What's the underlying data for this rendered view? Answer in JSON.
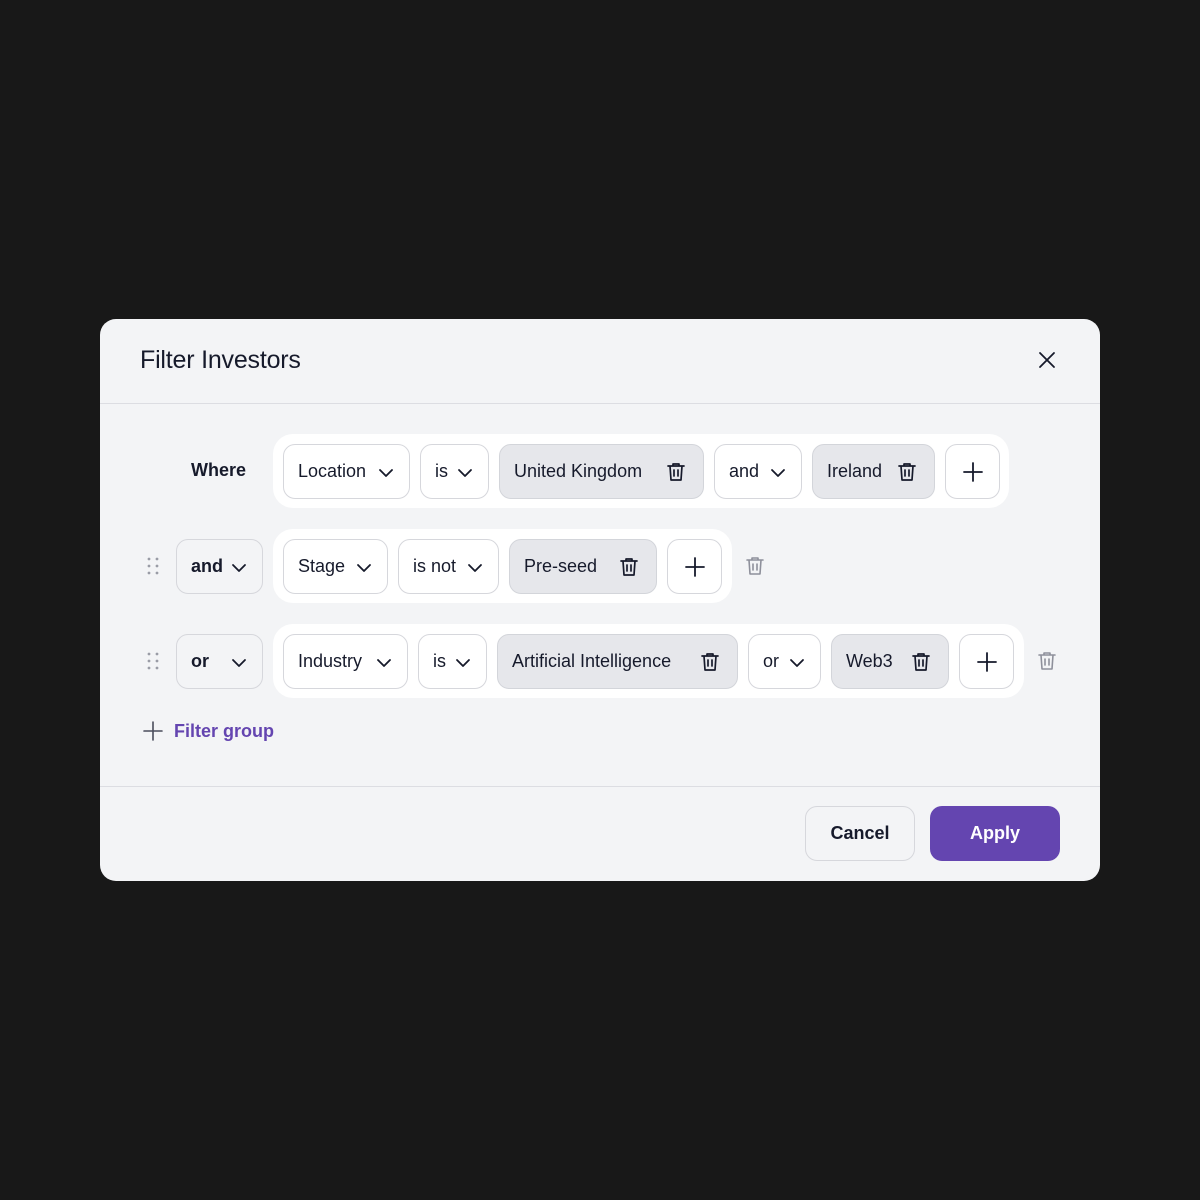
{
  "modal": {
    "title": "Filter Investors",
    "close_icon": "close-icon"
  },
  "rows": [
    {
      "prefix": "Where",
      "field": "Location",
      "operator": "is",
      "values": [
        "United Kingdom",
        "Ireland"
      ],
      "joiner": "and"
    },
    {
      "prefix": "and",
      "field": "Stage",
      "operator": "is not",
      "values": [
        "Pre-seed"
      ]
    },
    {
      "prefix": "or",
      "field": "Industry",
      "operator": "is",
      "values": [
        "Artificial Intelligence",
        "Web3"
      ],
      "joiner": "or"
    }
  ],
  "add_group": {
    "label": "Filter group"
  },
  "footer": {
    "cancel": "Cancel",
    "apply": "Apply"
  },
  "colors": {
    "accent": "#6445b0",
    "background": "#181818",
    "modal": "#f3f4f6",
    "chip": "#e6e7eb"
  }
}
